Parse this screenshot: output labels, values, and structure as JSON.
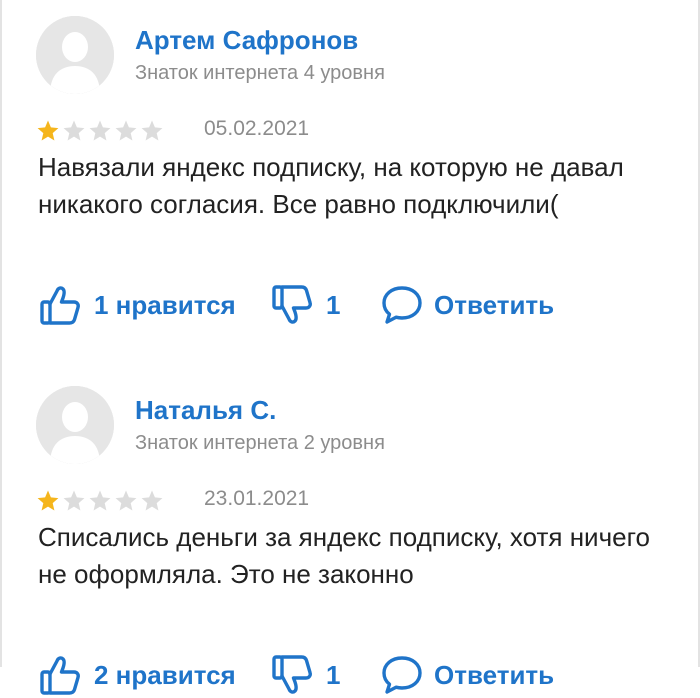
{
  "reviews": [
    {
      "author": "Артем Сафронов",
      "level": "Знаток интернета 4 уровня",
      "rating": 1,
      "rating_max": 5,
      "date": "05.02.2021",
      "text": "Навязали яндекс подписку, на которую не давал никакого согласия. Все равно подключили(",
      "like_label": "1 нравится",
      "dislike_count": "1",
      "reply_label": "Ответить"
    },
    {
      "author": "Наталья С.",
      "level": "Знаток интернета 2 уровня",
      "rating": 1,
      "rating_max": 5,
      "date": "23.01.2021",
      "text": "Списались деньги за яндекс подписку, хотя ничего не оформляла. Это не законно",
      "like_label": "2 нравится",
      "dislike_count": "1",
      "reply_label": "Ответить"
    }
  ],
  "colors": {
    "accent": "#1f74c9",
    "muted_text": "#8c8c8c",
    "body_text": "#222222",
    "star_filled": "#f5b51c",
    "star_empty": "#dcdcdc",
    "avatar_bg": "#e6e6e6"
  },
  "icons": {
    "avatar": "user-silhouette-icon",
    "like": "thumbs-up-icon",
    "dislike": "thumbs-down-icon",
    "reply": "speech-bubble-icon",
    "star": "star-icon"
  }
}
